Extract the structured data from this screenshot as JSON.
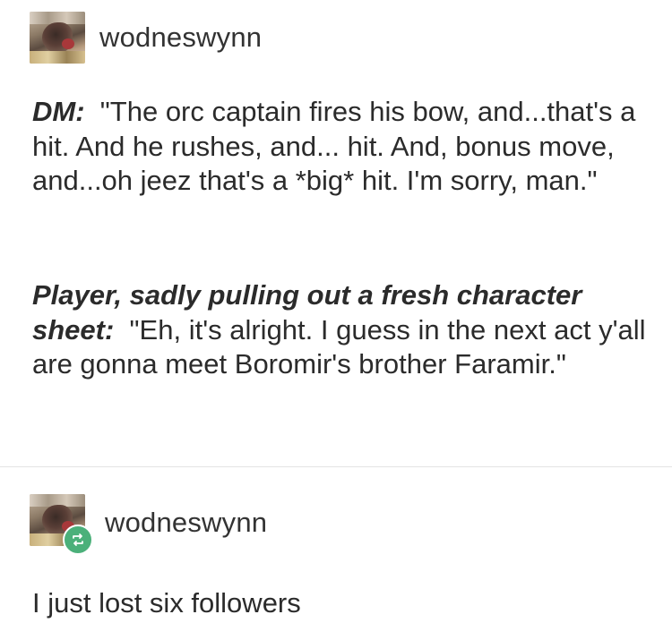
{
  "posts": [
    {
      "username": "wodneswynn",
      "paragraphs": [
        {
          "speaker": "DM:",
          "text": "\"The orc captain fires his bow, and...that's a hit.  And he rushes,  and... hit.  And, bonus move, and...oh jeez that's a *big* hit.  I'm  sorry, man.\""
        },
        {
          "speaker": "Player, sadly pulling out a fresh character sheet:",
          "text": "\"Eh, it's alright.  I guess in the next act y'all are gonna meet  Boromir's brother Faramir.\""
        }
      ]
    },
    {
      "username": "wodneswynn",
      "reblog_icon": "reblog-icon",
      "badge_color": "#4bb07a",
      "text": "I just lost six followers"
    }
  ]
}
